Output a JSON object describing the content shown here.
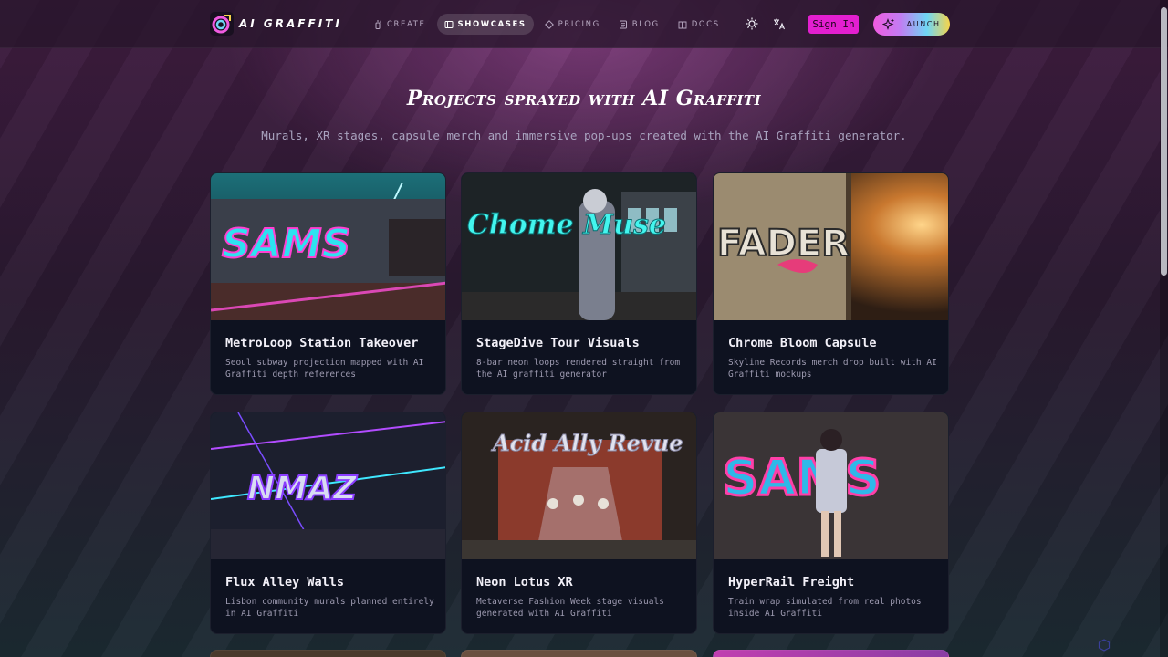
{
  "brand": {
    "name": "AI GRAFFITI",
    "logo_icon": "graffiti-logo-icon"
  },
  "nav": [
    {
      "label": "CREATE",
      "icon": "spray-can-icon",
      "active": false
    },
    {
      "label": "SHOWCASES",
      "icon": "gallery-icon",
      "active": true
    },
    {
      "label": "PRICING",
      "icon": "diamond-icon",
      "active": false
    },
    {
      "label": "BLOG",
      "icon": "newspaper-icon",
      "active": false
    },
    {
      "label": "DOCS",
      "icon": "book-icon",
      "active": false
    }
  ],
  "header_actions": {
    "theme_icon": "sun-icon",
    "language_icon": "translate-icon",
    "signin_label": "Sign In",
    "launch_label": "LAUNCH",
    "launch_icon": "sparkles-icon"
  },
  "hero": {
    "title": "Projects sprayed with AI Graffiti",
    "subtitle": "Murals, XR stages, capsule merch and immersive pop-ups created with the AI Graffiti generator."
  },
  "cards": [
    {
      "title": "MetroLoop Station Takeover",
      "description": "Seoul subway projection mapped with AI Graffiti depth references",
      "image_text": "SAMS"
    },
    {
      "title": "StageDive Tour Visuals",
      "description": "8-bar neon loops rendered straight from the AI graffiti generator",
      "image_text": "Chome Muse"
    },
    {
      "title": "Chrome Bloom Capsule",
      "description": "Skyline Records merch drop built with AI Graffiti mockups",
      "image_text": "FADER"
    },
    {
      "title": "Flux Alley Walls",
      "description": "Lisbon community murals planned entirely in AI Graffiti",
      "image_text": "NMAZ"
    },
    {
      "title": "Neon Lotus XR",
      "description": "Metaverse Fashion Week stage visuals generated with AI Graffiti",
      "image_text": "Acid Ally Revue"
    },
    {
      "title": "HyperRail Freight",
      "description": "Train wrap simulated from real photos inside AI Graffiti",
      "image_text": "SAMS"
    }
  ],
  "colors": {
    "accent_pink": "#e31fd0",
    "card_bg": "#0e1220",
    "neon_cyan": "#3ff0ff",
    "neon_magenta": "#ff3fd2"
  }
}
